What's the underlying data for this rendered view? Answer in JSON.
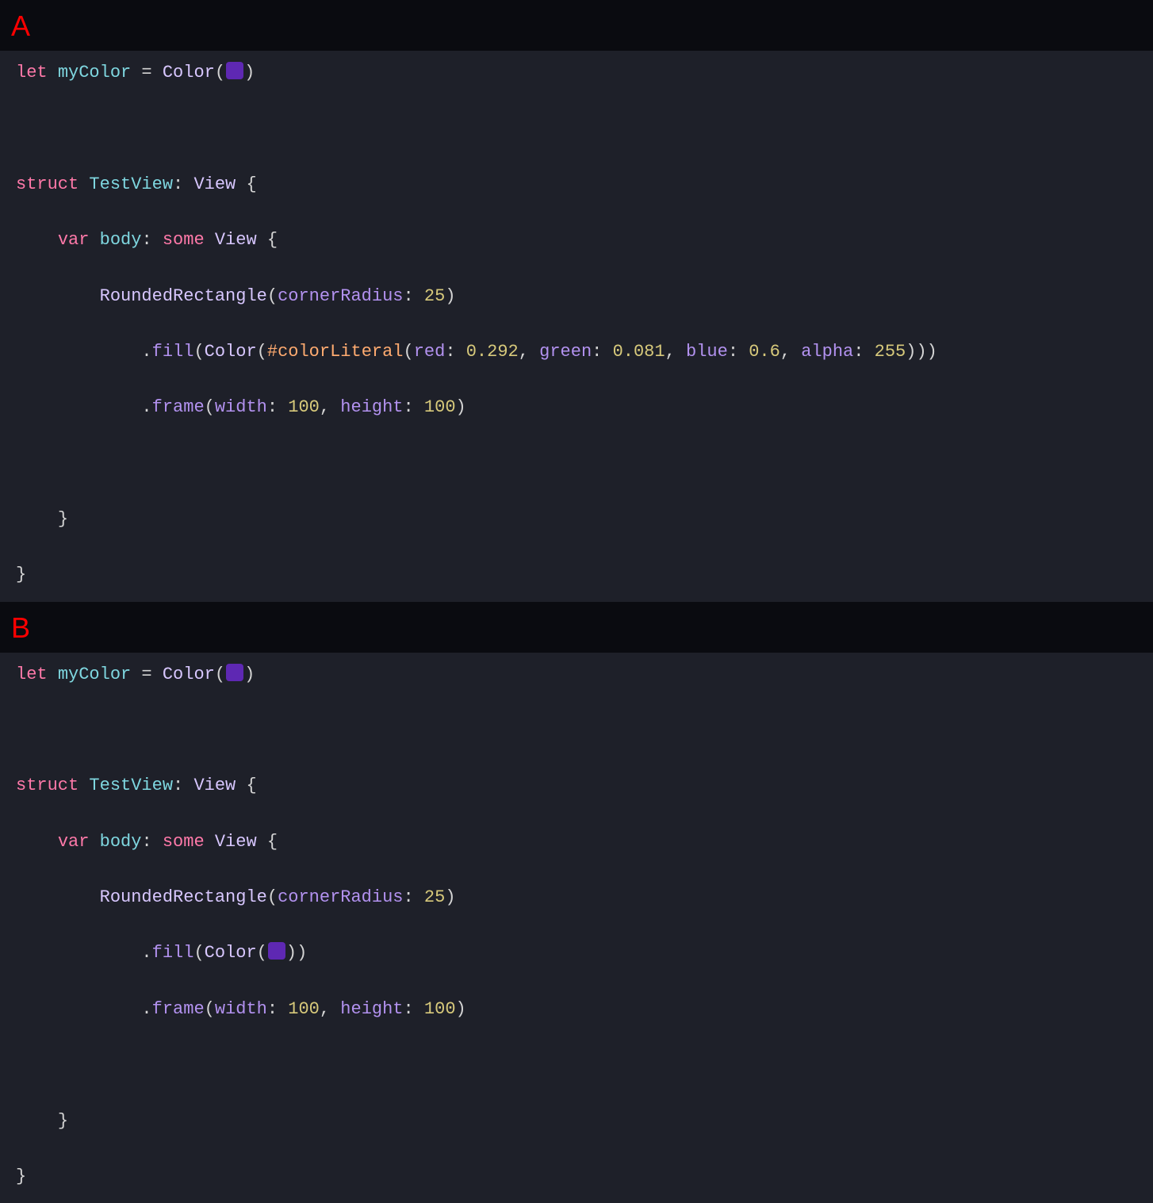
{
  "colors": {
    "swatch": "#5e28b3"
  },
  "panelA": {
    "label": "A",
    "l1_let": "let",
    "l1_myColor": "myColor",
    "l1_eq": " = ",
    "l1_Color": "Color",
    "l1_open": "(",
    "l1_close": ")",
    "l3_struct": "struct",
    "l3_TestView": "TestView",
    "l3_colon": ": ",
    "l3_View": "View",
    "l3_brace": " {",
    "l4_indent": "    ",
    "l4_var": "var",
    "l4_body": "body",
    "l4_colon": ": ",
    "l4_some": "some",
    "l4_View": "View",
    "l4_brace": " {",
    "l5_indent": "        ",
    "l5_RR": "RoundedRectangle",
    "l5_open": "(",
    "l5_corner": "cornerRadius",
    "l5_colon": ": ",
    "l5_val": "25",
    "l5_close": ")",
    "l6_indent": "            .",
    "l6_fill": "fill",
    "l6_open": "(",
    "l6_Color": "Color",
    "l6_open2": "(",
    "l6_macro": "#colorLiteral",
    "l6_open3": "(",
    "l6_red": "red",
    "l6_c1": ": ",
    "l6_rv": "0.292",
    "l6_s1": ", ",
    "l6_green": "green",
    "l6_c2": ": ",
    "l6_gv": "0.081",
    "l6_s2": ", ",
    "l6_blue": "blue",
    "l6_c3": ": ",
    "l6_bv": "0.6",
    "l6_s3": ", ",
    "l6_alpha": "alpha",
    "l6_c4": ": ",
    "l6_av": "255",
    "l6_close": ")))",
    "l7_indent": "            .",
    "l7_frame": "frame",
    "l7_open": "(",
    "l7_width": "width",
    "l7_c1": ": ",
    "l7_wv": "100",
    "l7_s1": ", ",
    "l7_height": "height",
    "l7_c2": ": ",
    "l7_hv": "100",
    "l7_close": ")",
    "l9_indent": "    ",
    "l9_brace": "}",
    "l10_brace": "}"
  },
  "panelB": {
    "label": "B",
    "l1_let": "let",
    "l1_myColor": "myColor",
    "l1_eq": " = ",
    "l1_Color": "Color",
    "l1_open": "(",
    "l1_close": ")",
    "l3_struct": "struct",
    "l3_TestView": "TestView",
    "l3_colon": ": ",
    "l3_View": "View",
    "l3_brace": " {",
    "l4_indent": "    ",
    "l4_var": "var",
    "l4_body": "body",
    "l4_colon": ": ",
    "l4_some": "some",
    "l4_View": "View",
    "l4_brace": " {",
    "l5_indent": "        ",
    "l5_RR": "RoundedRectangle",
    "l5_open": "(",
    "l5_corner": "cornerRadius",
    "l5_colon": ": ",
    "l5_val": "25",
    "l5_close": ")",
    "l6_indent": "            .",
    "l6_fill": "fill",
    "l6_open": "(",
    "l6_Color": "Color",
    "l6_open2": "(",
    "l6_close": "))",
    "l7_indent": "            .",
    "l7_frame": "frame",
    "l7_open": "(",
    "l7_width": "width",
    "l7_c1": ": ",
    "l7_wv": "100",
    "l7_s1": ", ",
    "l7_height": "height",
    "l7_c2": ": ",
    "l7_hv": "100",
    "l7_close": ")",
    "l9_indent": "    ",
    "l9_brace": "}",
    "l10_brace": "}"
  }
}
